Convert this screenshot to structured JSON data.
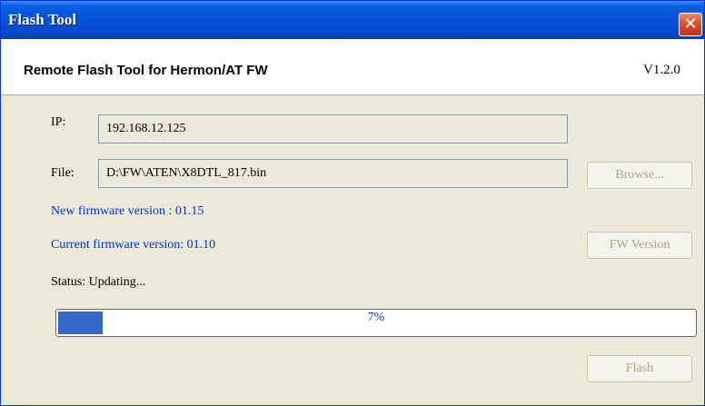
{
  "window": {
    "title": "Flash Tool",
    "close_glyph": "✕"
  },
  "header": {
    "app_title": "Remote Flash Tool for Hermon/AT FW",
    "version": "V1.2.0"
  },
  "form": {
    "ip_label": "IP:",
    "ip_value": "192.168.12.125",
    "file_label": "File:",
    "file_value": "D:\\FW\\ATEN\\X8DTL_817.bin",
    "browse_label": "Browse...",
    "new_fw_text": "New firmware version : 01.15",
    "current_fw_text": "Current firmware version: 01.10",
    "fw_version_label": "FW Version",
    "status_text": "Status: Updating...",
    "flash_label": "Flash"
  },
  "progress": {
    "percent": 7,
    "percent_text": "7%"
  },
  "colors": {
    "accent": "#3168c9",
    "link_text": "#0033cc",
    "titlebar": "#0551da"
  }
}
